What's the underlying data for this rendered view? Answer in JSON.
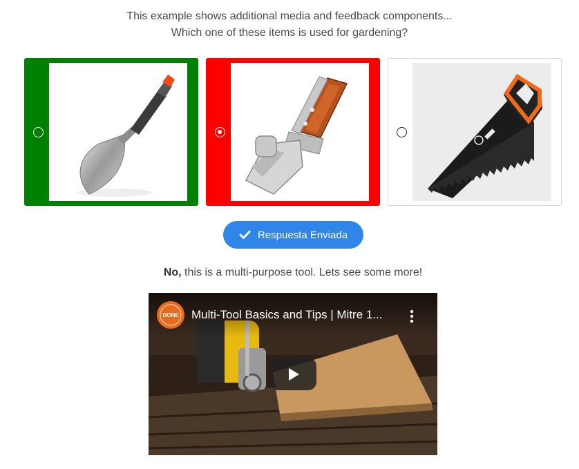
{
  "question": {
    "line1": "This example shows additional media and feedback components...",
    "line2": "Which one of these items is used for gardening?"
  },
  "options": [
    {
      "item": "garden-trowel",
      "state": "correct",
      "selected": false,
      "image_bg": "#ffffff"
    },
    {
      "item": "multi-tool-hammer",
      "state": "wrong",
      "selected": true,
      "image_bg": "#ffffff"
    },
    {
      "item": "hand-saw",
      "state": "neutral",
      "selected": false,
      "image_bg": "#ececec"
    }
  ],
  "submit": {
    "label": "Respuesta Enviada",
    "icon": "check-icon",
    "color": "#2f86e8"
  },
  "feedback": {
    "prefix": "No,",
    "text": " this is a multi-purpose tool. Lets see some more!"
  },
  "video": {
    "title": "Multi-Tool Basics and Tips | Mitre 1...",
    "channel_logo_text": "DONE",
    "icons": [
      "play-icon",
      "more-vert-icon"
    ]
  },
  "colors": {
    "correct": "#008000",
    "wrong": "#ff0000",
    "accent": "#2f86e8"
  }
}
